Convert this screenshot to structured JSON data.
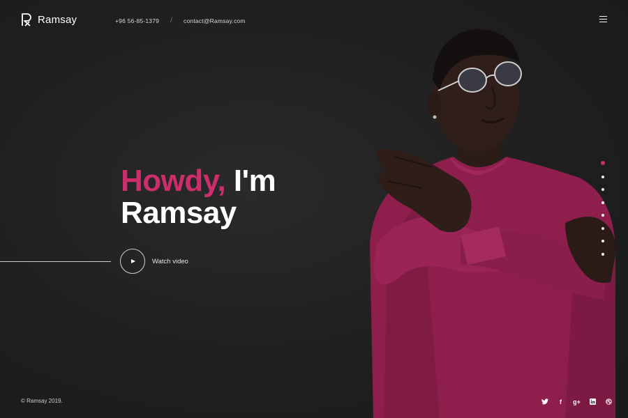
{
  "brand": {
    "name": "Ramsay",
    "logo_icon": "r-monogram-icon"
  },
  "header": {
    "phone": "+96 56-85-1379",
    "separator": "/",
    "email": "contact@Ramsay.com",
    "menu_icon": "hamburger-menu-icon"
  },
  "hero": {
    "greeting": "Howdy,",
    "intro": "I'm",
    "name": "Ramsay",
    "accent_color": "#cc2e6b",
    "watch_label": "Watch video",
    "play_icon": "play-icon"
  },
  "pager": {
    "count": 8,
    "active_index": 0
  },
  "footer": {
    "copyright": "© Ramsay 2019.",
    "socials": [
      {
        "name": "twitter-icon",
        "glyph": "🐦"
      },
      {
        "name": "facebook-icon",
        "glyph": "f"
      },
      {
        "name": "google-plus-icon",
        "glyph": "g+"
      },
      {
        "name": "linkedin-icon",
        "glyph": "in"
      },
      {
        "name": "dribbble-icon",
        "glyph": "◎"
      }
    ]
  }
}
